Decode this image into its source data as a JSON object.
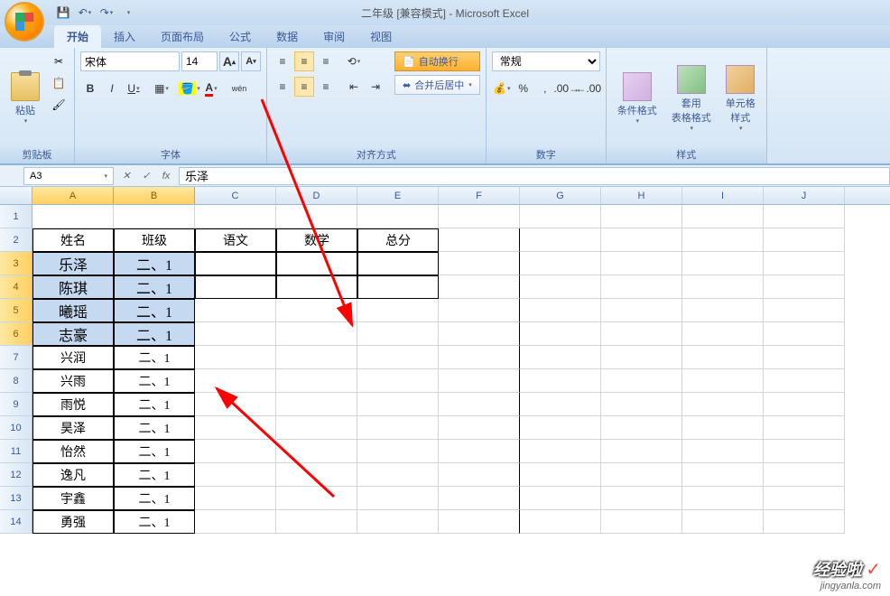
{
  "title": "二年级  [兼容模式] - Microsoft Excel",
  "tabs": [
    "开始",
    "插入",
    "页面布局",
    "公式",
    "数据",
    "审阅",
    "视图"
  ],
  "activeTab": 0,
  "ribbon": {
    "clipboard": {
      "label": "剪贴板",
      "paste": "粘贴"
    },
    "font": {
      "label": "字体",
      "name": "宋体",
      "size": "14",
      "increaseA": "A",
      "decreaseA": "A",
      "bold": "B",
      "italic": "I",
      "underline": "U",
      "pinyin": "wén"
    },
    "alignment": {
      "label": "对齐方式",
      "wrap": "自动换行",
      "merge": "合并后居中"
    },
    "number": {
      "label": "数字",
      "format": "常规"
    },
    "styles": {
      "label": "样式",
      "conditional": "条件格式",
      "table": "套用\n表格格式",
      "cell": "单元格\n样式"
    }
  },
  "nameBox": "A3",
  "formulaValue": "乐泽",
  "columns": [
    "A",
    "B",
    "C",
    "D",
    "E",
    "F",
    "G",
    "H",
    "I",
    "J"
  ],
  "colHeadersData": [
    "姓名",
    "班级",
    "语文",
    "数学",
    "总分"
  ],
  "rows": [
    {
      "num": 1,
      "cells": [
        "",
        "",
        "",
        "",
        "",
        "",
        "",
        "",
        "",
        ""
      ]
    },
    {
      "num": 2,
      "cells": [
        "姓名",
        "班级",
        "语文",
        "数学",
        "总分",
        "",
        "",
        "",
        "",
        ""
      ]
    },
    {
      "num": 3,
      "cells": [
        "乐泽",
        "二、1",
        "",
        "",
        "",
        "",
        "",
        "",
        "",
        ""
      ]
    },
    {
      "num": 4,
      "cells": [
        "陈琪",
        "二、1",
        "",
        "",
        "",
        "",
        "",
        "",
        "",
        ""
      ]
    },
    {
      "num": 5,
      "cells": [
        "曦瑶",
        "二、1",
        "",
        "",
        "",
        "",
        "",
        "",
        "",
        ""
      ]
    },
    {
      "num": 6,
      "cells": [
        "志豪",
        "二、1",
        "",
        "",
        "",
        "",
        "",
        "",
        "",
        ""
      ]
    },
    {
      "num": 7,
      "cells": [
        "兴润",
        "二、1",
        "",
        "",
        "",
        "",
        "",
        "",
        "",
        ""
      ]
    },
    {
      "num": 8,
      "cells": [
        "兴雨",
        "二、1",
        "",
        "",
        "",
        "",
        "",
        "",
        "",
        ""
      ]
    },
    {
      "num": 9,
      "cells": [
        "雨悦",
        "二、1",
        "",
        "",
        "",
        "",
        "",
        "",
        "",
        ""
      ]
    },
    {
      "num": 10,
      "cells": [
        "昊泽",
        "二、1",
        "",
        "",
        "",
        "",
        "",
        "",
        "",
        ""
      ]
    },
    {
      "num": 11,
      "cells": [
        "怡然",
        "二、1",
        "",
        "",
        "",
        "",
        "",
        "",
        "",
        ""
      ]
    },
    {
      "num": 12,
      "cells": [
        "逸凡",
        "二、1",
        "",
        "",
        "",
        "",
        "",
        "",
        "",
        ""
      ]
    },
    {
      "num": 13,
      "cells": [
        "宇鑫",
        "二、1",
        "",
        "",
        "",
        "",
        "",
        "",
        "",
        ""
      ]
    },
    {
      "num": 14,
      "cells": [
        "勇强",
        "二、1",
        "",
        "",
        "",
        "",
        "",
        "",
        "",
        ""
      ]
    }
  ],
  "selectedRange": {
    "startRow": 3,
    "endRow": 6,
    "startCol": 0,
    "endCol": 1
  },
  "watermark": {
    "main": "经验啦",
    "sub": "jingyanla.com"
  }
}
